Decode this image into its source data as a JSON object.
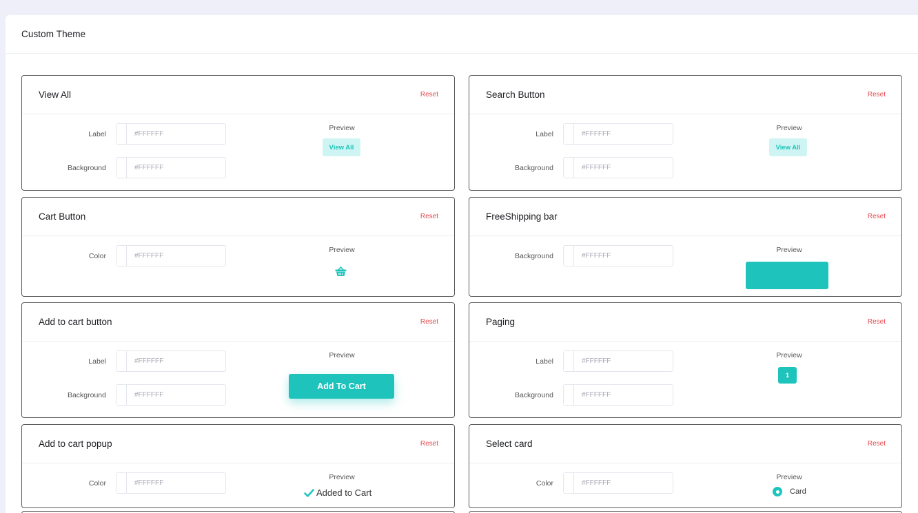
{
  "page": {
    "title": "Custom Theme"
  },
  "colors": {
    "accent": "#1EC4BC",
    "accent_light": "#CEF5F3",
    "reset": "#E5484D"
  },
  "common": {
    "reset_label": "Reset",
    "preview_label": "Preview",
    "hex_placeholder": "#FFFFFF"
  },
  "view_all": {
    "title": "View All",
    "label_field": "Label",
    "background_field": "Background",
    "preview_button": "View All"
  },
  "search_button": {
    "title": "Search Button",
    "label_field": "Label",
    "background_field": "Background",
    "preview_button": "View All"
  },
  "cart_button": {
    "title": "Cart Button",
    "color_field": "Color",
    "preview_icon": "basket-icon"
  },
  "free_shipping": {
    "title": "FreeShipping bar",
    "background_field": "Background"
  },
  "add_to_cart": {
    "title": "Add to cart button",
    "label_field": "Label",
    "background_field": "Background",
    "preview_button": "Add To Cart"
  },
  "paging": {
    "title": "Paging",
    "label_field": "Label",
    "background_field": "Background",
    "preview_page": "1"
  },
  "add_to_cart_popup": {
    "title": "Add to cart popup",
    "color_field": "Color",
    "preview_text": "Added to Cart",
    "preview_icon": "checkmark-icon"
  },
  "select_card": {
    "title": "Select card",
    "color_field": "Color",
    "preview_text": "Card"
  }
}
